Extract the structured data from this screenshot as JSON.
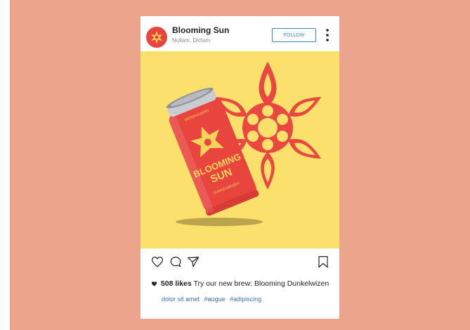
{
  "post": {
    "account_name": "Blooming Sun",
    "account_subtitle": "Nullam, Dictum",
    "follow_label": "FOLLOW",
    "likes": "508 likes",
    "caption": "Try our new brew: Blooming Dunkelwizen",
    "caption_line2": "dolor sit amet",
    "hashtags": [
      "#augue",
      "#adipiscing"
    ]
  },
  "can": {
    "brand_line1": "BLOOMING",
    "brand_line2": "SUN",
    "small_top": "BIERBRAUEREI",
    "small_bottom": "DUNKELWEIZEN"
  },
  "icons": {
    "more": "more-vertical-icon",
    "like": "heart-outline-icon",
    "comment": "comment-icon",
    "share": "send-icon",
    "save": "bookmark-icon",
    "likes_heart": "heart-filled-icon"
  },
  "colors": {
    "background": "#eba58c",
    "photo_background": "#fbe06b",
    "brand_red": "#e8453f",
    "link_blue": "#3d86c6"
  }
}
